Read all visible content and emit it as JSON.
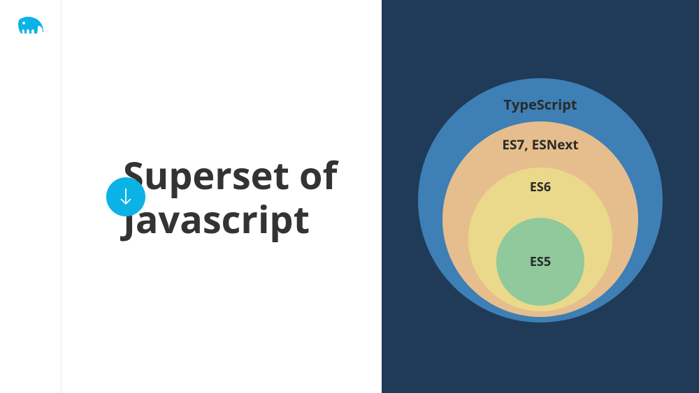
{
  "title": "Superset of\nJavascript",
  "logo": {
    "name": "elephant-logo",
    "color": "#0bb2e6"
  },
  "accent_color": "#0bb2e6",
  "right_panel_bg": "#1f3b58",
  "diagram": {
    "type": "nested-circles",
    "rings": [
      {
        "label": "TypeScript",
        "color": "#3e7fb5"
      },
      {
        "label": "ES7, ESNext",
        "color": "#e6be8d"
      },
      {
        "label": "ES6",
        "color": "#ebd98b"
      },
      {
        "label": "ES5",
        "color": "#8fc99c"
      }
    ]
  }
}
